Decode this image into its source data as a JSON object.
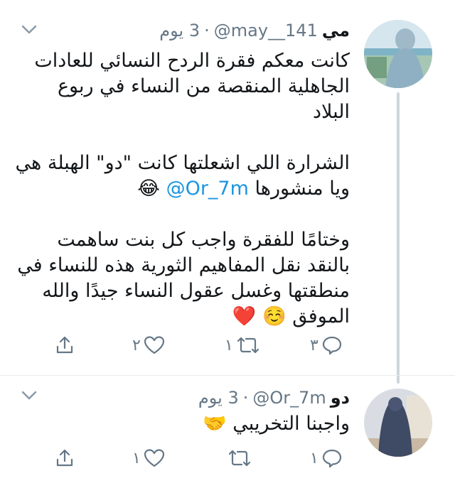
{
  "tweets": [
    {
      "display_name": "مي",
      "handle": "@may__141",
      "separator": "·",
      "time": "3 يوم",
      "body_lines": [
        "كانت معكم فقرة الردح النسائي للعادات",
        "الجاهلية المنقصة من النساء في ربوع",
        "البلاد",
        "",
        "الشرارة اللي اشعلتها كانت \"دو\" الهبلة هي",
        "",
        "",
        "وختامًا للفقرة واجب كل بنت ساهمت",
        "بالنقد نقل المفاهيم الثورية هذه للنساء في",
        "منطقتها وغسل عقول النساء جيدًا والله",
        ""
      ],
      "mention_line": {
        "prefix": "ويا منشورها ",
        "mention": "@Or_7m",
        "suffix": " 😂"
      },
      "closing_line": {
        "text": "الموفق",
        "emojis": "☺️ ❤️"
      },
      "actions": {
        "replies": "٣",
        "retweets": "١",
        "likes": "٢"
      },
      "icons": [
        "chevron-down-icon",
        "reply-icon",
        "retweet-icon",
        "heart-icon",
        "share-icon"
      ]
    },
    {
      "display_name": "دو",
      "handle": "@Or_7m",
      "separator": "·",
      "time": "3 يوم",
      "body_text": "واجبنا التخريبي",
      "body_emoji": "🤝",
      "actions": {
        "replies": "١",
        "retweets": "",
        "likes": "١"
      }
    }
  ],
  "colors": {
    "link": "#1b95e0",
    "muted": "#657786",
    "thread_line": "#ccd6dd"
  }
}
